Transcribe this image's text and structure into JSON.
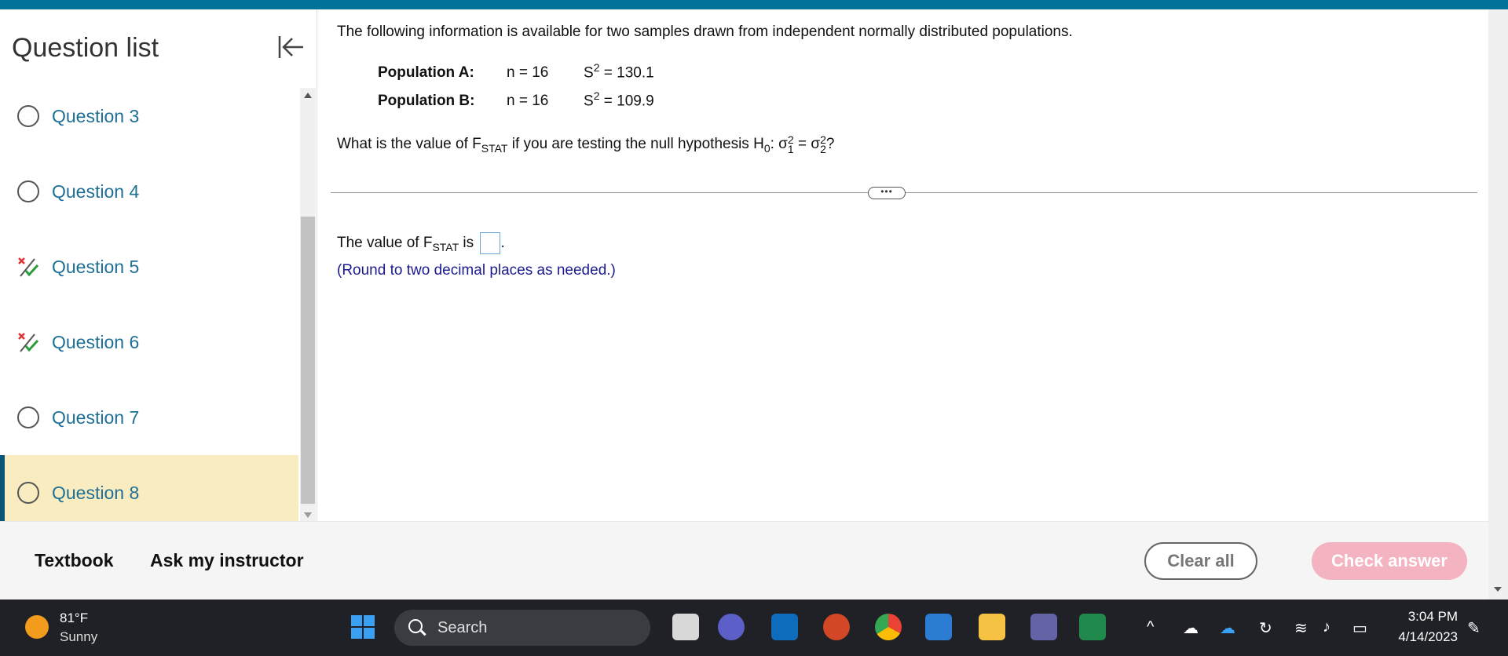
{
  "sidebar": {
    "title": "Question list",
    "items": [
      {
        "label": "Question 3",
        "status": "unanswered"
      },
      {
        "label": "Question 4",
        "status": "unanswered"
      },
      {
        "label": "Question 5",
        "status": "partial"
      },
      {
        "label": "Question 6",
        "status": "partial"
      },
      {
        "label": "Question 7",
        "status": "unanswered"
      },
      {
        "label": "Question 8",
        "status": "unanswered",
        "active": true
      }
    ]
  },
  "problem": {
    "intro": "The following information is available for two samples drawn from independent normally distributed populations.",
    "populations": [
      {
        "label": "Population A:",
        "n": "n = 16",
        "s_base": "S",
        "s_exp": "2",
        "s_value": " = 130.1"
      },
      {
        "label": "Population B:",
        "n": "n = 16",
        "s_base": "S",
        "s_exp": "2",
        "s_value": " = 109.9"
      }
    ],
    "question_prefix": "What is the value of F",
    "question_sub": "STAT",
    "question_mid": " if you are testing the null hypothesis H",
    "question_h_sub": "0",
    "question_tail": ": σ",
    "sigma1_sup": "2",
    "sigma1_sub": "1",
    "equals": " = σ",
    "sigma2_sup": "2",
    "sigma2_sub": "2",
    "question_end": "?",
    "more_label": "•••",
    "answer_prefix": "The value of F",
    "answer_sub": "STAT",
    "answer_mid": " is ",
    "answer_end": ".",
    "hint": "(Round to two decimal places as needed.)"
  },
  "footer": {
    "textbook": "Textbook",
    "ask_instructor": "Ask my instructor",
    "clear_all": "Clear all",
    "check_answer": "Check answer"
  },
  "taskbar": {
    "temp": "81°F",
    "weather": "Sunny",
    "search": "Search",
    "time": "3:04 PM",
    "date": "4/14/2023"
  },
  "colors": {
    "accent": "#007398",
    "link": "#1e6f96",
    "active_bg": "#f8ecc0",
    "check_btn": "#f4b3c1",
    "hint": "#1b1b8f"
  }
}
